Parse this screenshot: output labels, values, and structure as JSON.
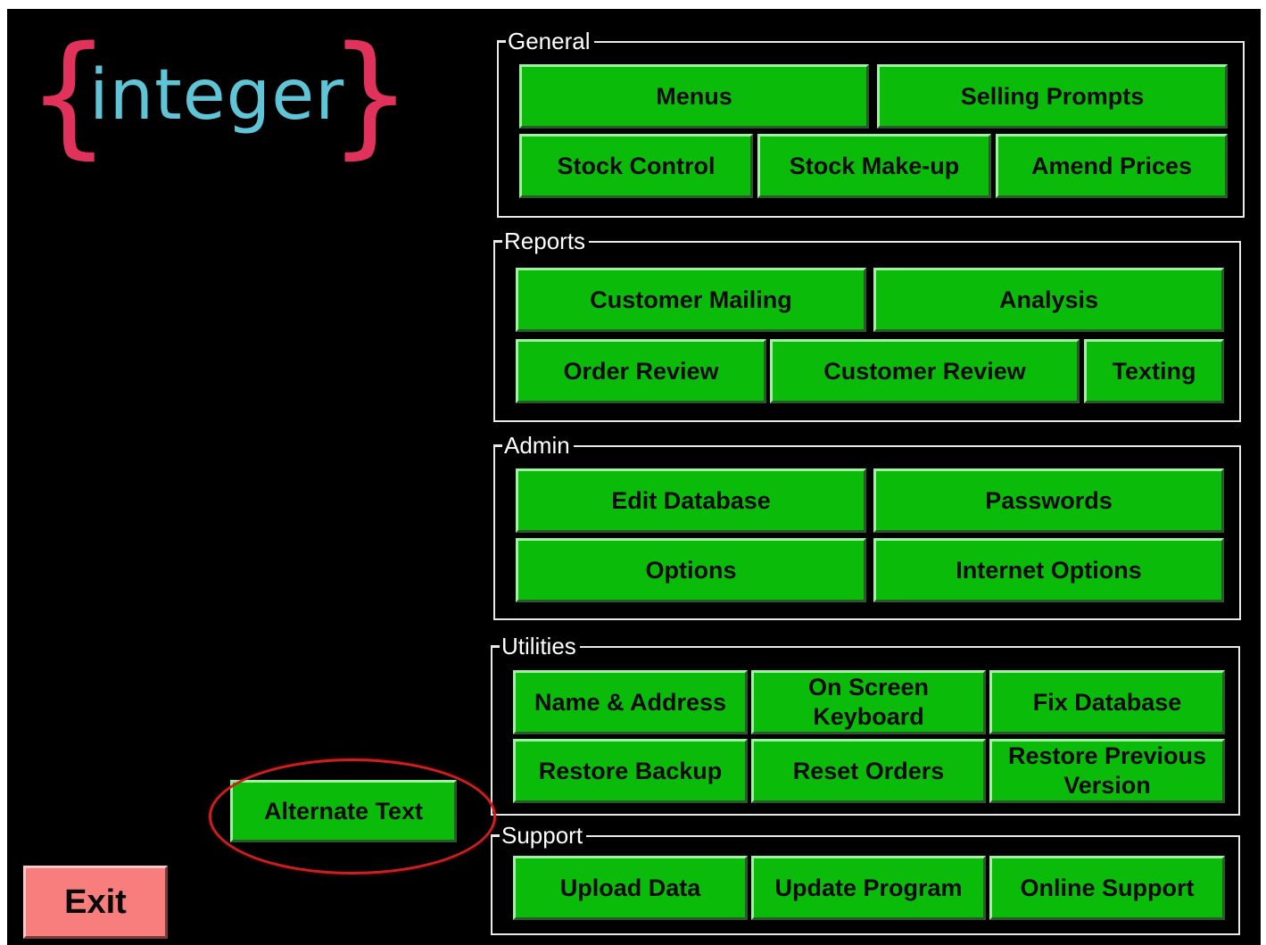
{
  "logo": {
    "brace_left": "{",
    "word": "integer",
    "brace_right": "}",
    "brace_color": "#e0325a",
    "word_color": "#5ec4d6"
  },
  "groups": {
    "general": {
      "legend": "General",
      "buttons": [
        "Menus",
        "Selling Prompts",
        "Stock Control",
        "Stock Make-up",
        "Amend Prices"
      ]
    },
    "reports": {
      "legend": "Reports",
      "buttons": [
        "Customer Mailing",
        "Analysis",
        "Order Review",
        "Customer Review",
        "Texting"
      ]
    },
    "admin": {
      "legend": "Admin",
      "buttons": [
        "Edit Database",
        "Passwords",
        "Options",
        "Internet Options"
      ]
    },
    "utilities": {
      "legend": "Utilities",
      "buttons": [
        "Name & Address",
        "On Screen",
        "Keyboard",
        "Fix Database",
        "Restore Backup",
        "Reset Orders",
        "Restore Previous",
        "Version"
      ]
    },
    "support": {
      "legend": "Support",
      "buttons": [
        "Upload Data",
        "Update Program",
        "Online Support"
      ]
    }
  },
  "alternate_text_label": "Alternate Text",
  "exit_label": "Exit",
  "colors": {
    "background": "#000000",
    "button_green": "#0abb0a",
    "exit_red": "#f87e7e",
    "highlight_ring": "#cc1f1f"
  }
}
